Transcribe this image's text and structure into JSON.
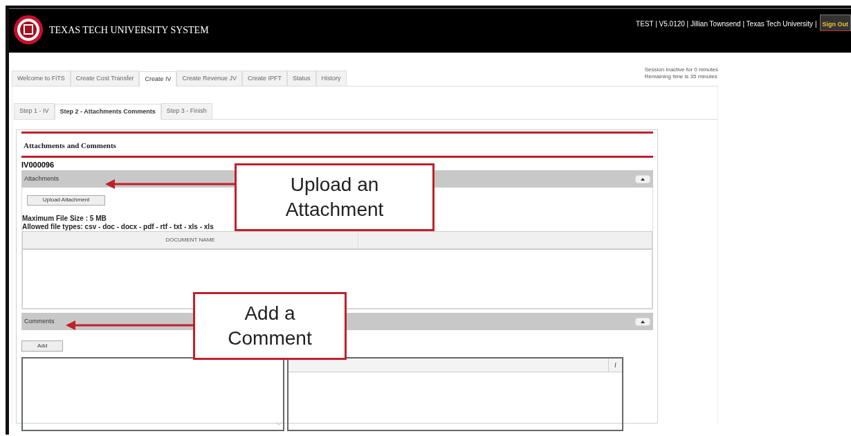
{
  "header": {
    "logo_text": "TEXAS TECH UNIVERSITY SYSTEM",
    "user_info": "TEST | V5.0120 | Jillian Townsend | Texas Tech University |",
    "sign_out": "Sign Out"
  },
  "session": [
    "Session inactive for 0 minutes",
    "Remaining time is 35 minutes"
  ],
  "tabs": [
    {
      "label": "Welcome to FiTS",
      "selected": false
    },
    {
      "label": "Create Cost Transfer",
      "selected": false
    },
    {
      "label": "Create IV",
      "selected": true
    },
    {
      "label": "Create Revenue JV",
      "selected": false
    },
    {
      "label": "Create IPFT",
      "selected": false
    },
    {
      "label": "Status",
      "selected": false
    },
    {
      "label": "History",
      "selected": false
    }
  ],
  "steps": [
    {
      "label": "Step 1 - IV",
      "selected": false
    },
    {
      "label": "Step 2 - Attachments Comments",
      "selected": true
    },
    {
      "label": "Step 3 - Finish",
      "selected": false
    }
  ],
  "panel": {
    "title": "Attachments and Comments",
    "record_id": "IV000096",
    "attachments": {
      "label": "Attachments",
      "expanded": true,
      "upload_button": "Upload Attachment",
      "max_size": "Maximum File Size : 5 MB",
      "allowed_types": "Allowed file types: csv - doc - docx - pdf - rtf - txt - xls - xls",
      "columns": [
        "DOCUMENT NAME"
      ]
    },
    "comments": {
      "label": "Comments",
      "expanded": true,
      "add_button": "Add"
    }
  },
  "callouts": [
    {
      "text": "Upload an Attachment"
    },
    {
      "text": "Add a Comment"
    }
  ]
}
